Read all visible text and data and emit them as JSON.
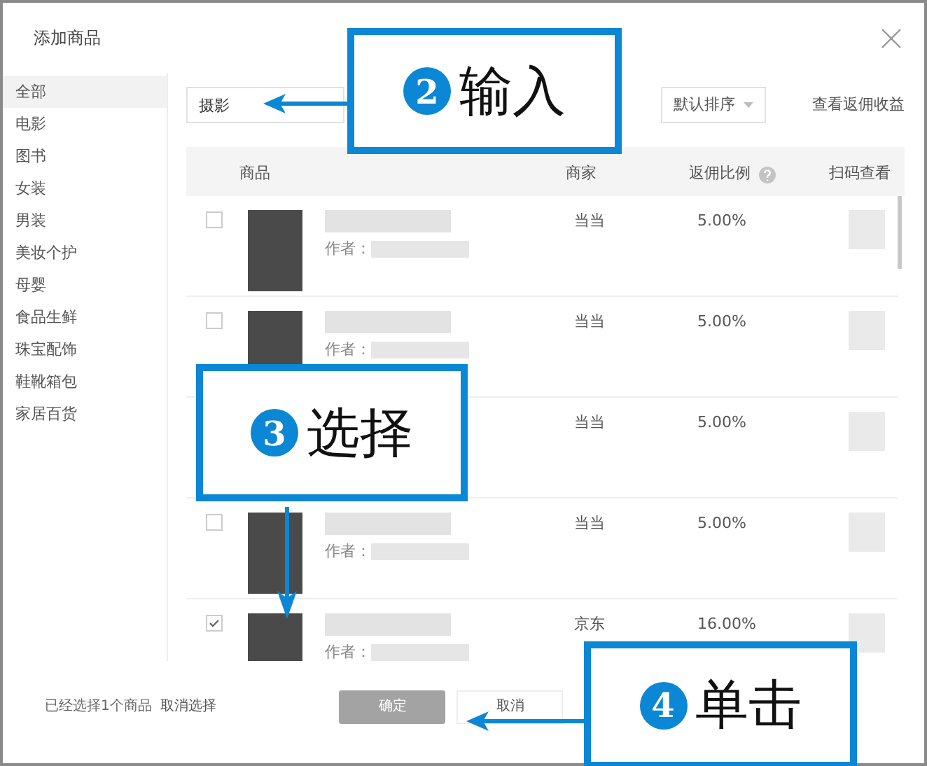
{
  "dialog": {
    "title": "添加商品"
  },
  "categories": [
    {
      "label": "全部",
      "selected": true
    },
    {
      "label": "电影",
      "selected": false
    },
    {
      "label": "图书",
      "selected": false
    },
    {
      "label": "女装",
      "selected": false
    },
    {
      "label": "男装",
      "selected": false
    },
    {
      "label": "美妆个护",
      "selected": false
    },
    {
      "label": "母婴",
      "selected": false
    },
    {
      "label": "食品生鲜",
      "selected": false
    },
    {
      "label": "珠宝配饰",
      "selected": false
    },
    {
      "label": "鞋靴箱包",
      "selected": false
    },
    {
      "label": "家居百货",
      "selected": false
    }
  ],
  "search": {
    "value": "摄影"
  },
  "sort": {
    "label": "默认排序"
  },
  "earnings_link": "查看返佣收益",
  "table": {
    "columns": [
      "商品",
      "商家",
      "返佣比例",
      "扫码查看"
    ],
    "rows": [
      {
        "checked": false,
        "author_label": "作者：",
        "merchant": "当当",
        "rate": "5.00%"
      },
      {
        "checked": false,
        "author_label": "作者：",
        "merchant": "当当",
        "rate": "5.00%"
      },
      {
        "merchant": "当当",
        "rate": "5.00%"
      },
      {
        "checked": false,
        "author_label": "作者：",
        "merchant": "当当",
        "rate": "5.00%"
      },
      {
        "checked": true,
        "author_label": "作者：",
        "merchant": "京东",
        "rate": "16.00%"
      }
    ]
  },
  "footer": {
    "selection_text": "已经选择1个商品",
    "clear_link": "取消选择",
    "confirm": "确定",
    "cancel": "取消"
  },
  "callouts": [
    {
      "number": "2",
      "label": "输入"
    },
    {
      "number": "3",
      "label": "选择"
    },
    {
      "number": "4",
      "label": "单击"
    }
  ]
}
